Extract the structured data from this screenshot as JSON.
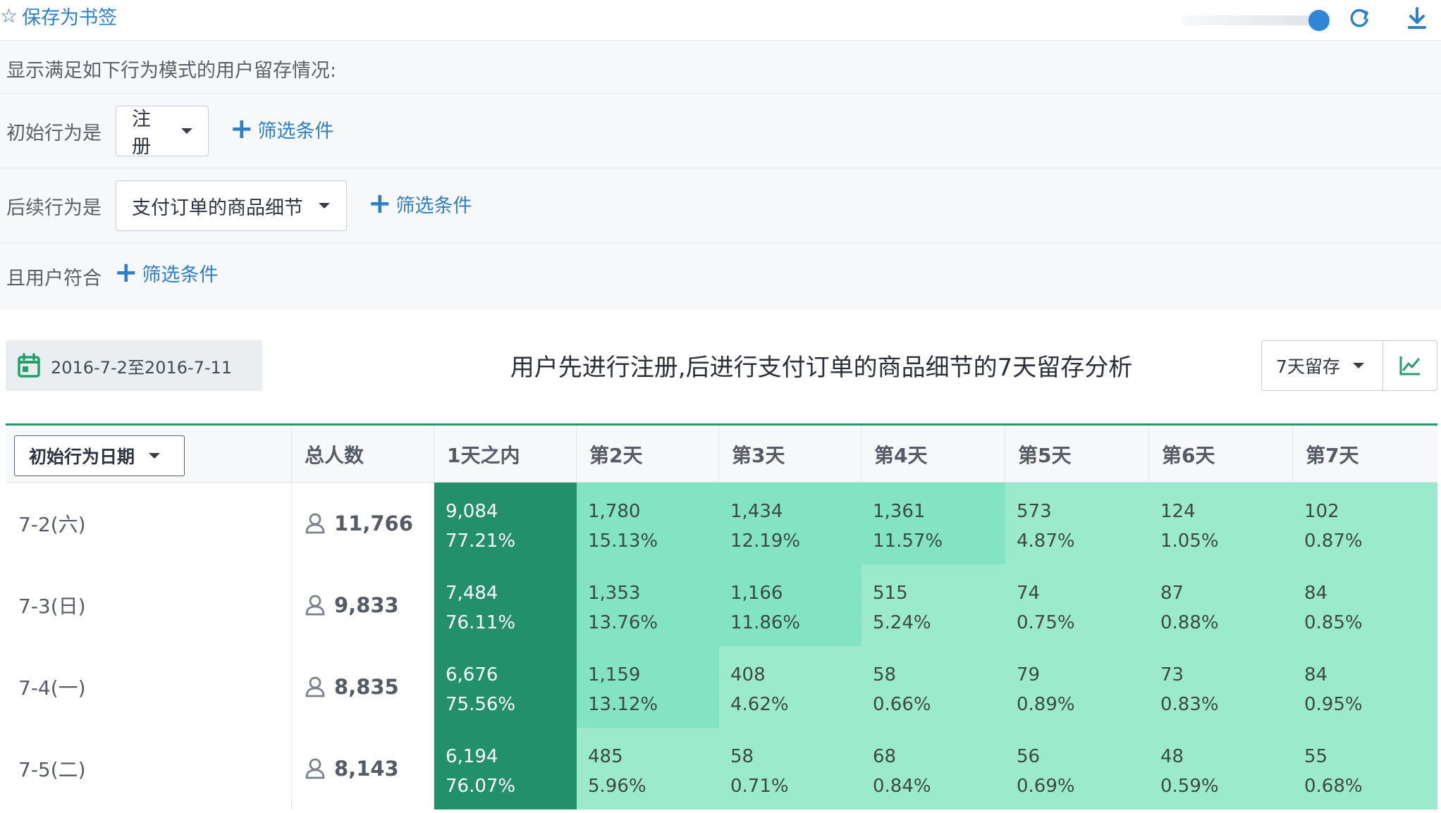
{
  "topbar": {
    "bookmark_label": "保存为书签",
    "slider_value": 0.95
  },
  "filters": {
    "description": "显示满足如下行为模式的用户留存情况:",
    "initial_label": "初始行为是",
    "initial_value": "注册",
    "next_label": "后续行为是",
    "next_value": "支付订单的商品细节",
    "user_label": "且用户符合",
    "add_condition_label": "筛选条件"
  },
  "report": {
    "date_range": "2016-7-2至2016-7-11",
    "title": "用户先进行注册,后进行支付订单的商品细节的7天留存分析",
    "retention_select": "7天留存"
  },
  "colors": {
    "accent": "#2f7fc6",
    "table_border": "#22986a",
    "heat_dark": "#22906a",
    "heat_mid": "#82e4c2",
    "heat_light": "#9beacd"
  },
  "table": {
    "date_select": "初始行为日期",
    "total_header": "总人数",
    "day_headers": [
      "1天之内",
      "第2天",
      "第3天",
      "第4天",
      "第5天",
      "第6天",
      "第7天"
    ],
    "rows": [
      {
        "date": "7-2(六)",
        "total": "11,766",
        "cells": [
          {
            "count": "9,084",
            "pct": "77.21%"
          },
          {
            "count": "1,780",
            "pct": "15.13%"
          },
          {
            "count": "1,434",
            "pct": "12.19%"
          },
          {
            "count": "1,361",
            "pct": "11.57%"
          },
          {
            "count": "573",
            "pct": "4.87%"
          },
          {
            "count": "124",
            "pct": "1.05%"
          },
          {
            "count": "102",
            "pct": "0.87%"
          }
        ]
      },
      {
        "date": "7-3(日)",
        "total": "9,833",
        "cells": [
          {
            "count": "7,484",
            "pct": "76.11%"
          },
          {
            "count": "1,353",
            "pct": "13.76%"
          },
          {
            "count": "1,166",
            "pct": "11.86%"
          },
          {
            "count": "515",
            "pct": "5.24%"
          },
          {
            "count": "74",
            "pct": "0.75%"
          },
          {
            "count": "87",
            "pct": "0.88%"
          },
          {
            "count": "84",
            "pct": "0.85%"
          }
        ]
      },
      {
        "date": "7-4(一)",
        "total": "8,835",
        "cells": [
          {
            "count": "6,676",
            "pct": "75.56%"
          },
          {
            "count": "1,159",
            "pct": "13.12%"
          },
          {
            "count": "408",
            "pct": "4.62%"
          },
          {
            "count": "58",
            "pct": "0.66%"
          },
          {
            "count": "79",
            "pct": "0.89%"
          },
          {
            "count": "73",
            "pct": "0.83%"
          },
          {
            "count": "84",
            "pct": "0.95%"
          }
        ]
      },
      {
        "date": "7-5(二)",
        "total": "8,143",
        "cells": [
          {
            "count": "6,194",
            "pct": "76.07%"
          },
          {
            "count": "485",
            "pct": "5.96%"
          },
          {
            "count": "58",
            "pct": "0.71%"
          },
          {
            "count": "68",
            "pct": "0.84%"
          },
          {
            "count": "56",
            "pct": "0.69%"
          },
          {
            "count": "48",
            "pct": "0.59%"
          },
          {
            "count": "55",
            "pct": "0.68%"
          }
        ]
      }
    ]
  }
}
